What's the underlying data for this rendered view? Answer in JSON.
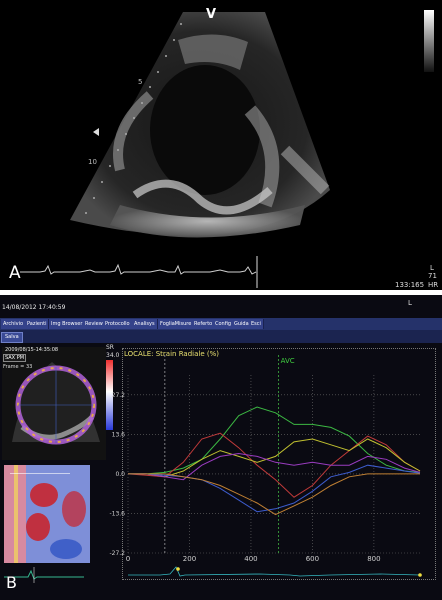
{
  "panel_a": {
    "label": "A",
    "marker_v": "V",
    "depth_5": "5",
    "depth_10": "10",
    "marker_l": "L",
    "value_71": "71",
    "readout": "133:165",
    "hr": "HR"
  },
  "panel_b": {
    "label": "B",
    "datetime": "14/08/2012 17:40:59",
    "marker_l": "L",
    "menu": [
      "Archivio",
      "Pazienti",
      "Img Browser",
      "Review",
      "Protocollo",
      "Analisys",
      "FogliaMisure",
      "Referto",
      "Config",
      "Guida",
      "Esci"
    ],
    "save_button": "Salva",
    "image_timestamp": "2009/08/15-14:35:08",
    "view_label": "SAX PM",
    "frame_label": "Frame = 33",
    "sr_label": "SR",
    "sr_max": "34.0",
    "chart_data": {
      "type": "line",
      "title": "LOCALE:  Strain Radiale (%)",
      "event_marker": "AVC",
      "event_x": 490,
      "xlim": [
        0,
        950
      ],
      "x_ticks": [
        "0",
        "200",
        "400",
        "600",
        "800"
      ],
      "x_tick_values": [
        0,
        200,
        400,
        600,
        800
      ],
      "ylim": [
        -27.2,
        34.0
      ],
      "y_ticks": [
        "27.2",
        "13.6",
        "0.0",
        "-13.6",
        "-27.2"
      ],
      "y_tick_values": [
        27.2,
        13.6,
        0.0,
        -13.6,
        -27.2
      ],
      "grid": true,
      "x": [
        0,
        60,
        120,
        180,
        240,
        300,
        360,
        420,
        480,
        540,
        600,
        660,
        720,
        780,
        840,
        900,
        950
      ],
      "series": [
        {
          "color": "#3cb843",
          "values": [
            0,
            0,
            0.5,
            2,
            5,
            12,
            20,
            23,
            21,
            17,
            17,
            16,
            13,
            7,
            3,
            1,
            0.5
          ]
        },
        {
          "color": "#c03a3a",
          "values": [
            0,
            -0.5,
            -1,
            4,
            12,
            14,
            9,
            3,
            -2,
            -8,
            -4,
            3,
            8,
            13,
            10,
            4,
            1
          ]
        },
        {
          "color": "#c0c030",
          "values": [
            0,
            0,
            -1,
            1,
            5,
            8,
            6,
            4,
            6,
            11,
            12,
            10,
            8,
            12,
            9,
            4,
            1
          ]
        },
        {
          "color": "#9a3cc0",
          "values": [
            0,
            0,
            -1,
            -2,
            3,
            6,
            7,
            6,
            4,
            3,
            4,
            3,
            3,
            6,
            5,
            2,
            0.5
          ]
        },
        {
          "color": "#3d5ccd",
          "values": [
            0,
            0,
            -0.5,
            -1,
            -2,
            -5,
            -9,
            -13,
            -12,
            -10,
            -6,
            -1,
            0.5,
            3,
            2,
            1,
            0.2
          ]
        },
        {
          "color": "#c08033",
          "values": [
            0,
            0,
            0,
            -1,
            -2,
            -4,
            -7,
            -10,
            -14,
            -11,
            -8,
            -4,
            -1,
            0,
            0,
            0,
            0
          ]
        }
      ]
    }
  }
}
